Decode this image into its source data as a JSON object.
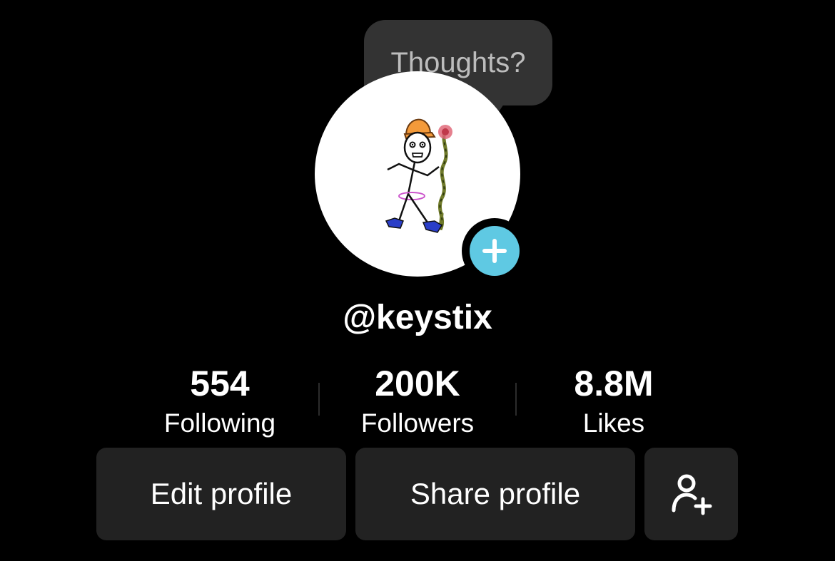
{
  "profile": {
    "username": "@keystix",
    "tooltip": "Thoughts?",
    "avatar_icon": "stick-figure-avatar",
    "add_icon": "plus-icon",
    "accent_color": "#5fc9e3"
  },
  "stats": [
    {
      "value": "554",
      "label": "Following"
    },
    {
      "value": "200K",
      "label": "Followers"
    },
    {
      "value": "8.8M",
      "label": "Likes"
    }
  ],
  "actions": {
    "edit_label": "Edit profile",
    "share_label": "Share profile",
    "add_friend_icon": "add-user-icon"
  }
}
